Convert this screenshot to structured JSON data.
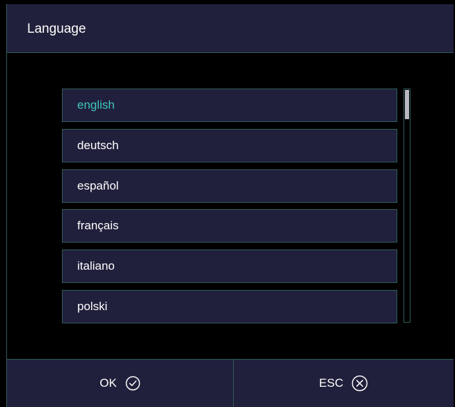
{
  "dialog": {
    "title": "Language"
  },
  "languages": [
    {
      "label": "english",
      "selected": true
    },
    {
      "label": "deutsch",
      "selected": false
    },
    {
      "label": "español",
      "selected": false
    },
    {
      "label": "français",
      "selected": false
    },
    {
      "label": "italiano",
      "selected": false
    },
    {
      "label": "polski",
      "selected": false
    }
  ],
  "scrollbar": {
    "position": 0
  },
  "footer": {
    "ok_label": "OK",
    "ok_icon": "check-circle-icon",
    "esc_label": "ESC",
    "esc_icon": "close-circle-icon"
  },
  "colors": {
    "panel": "#20203c",
    "border": "#2e5e5a",
    "selected_text": "#3fc5bc",
    "text": "#ffffff"
  }
}
